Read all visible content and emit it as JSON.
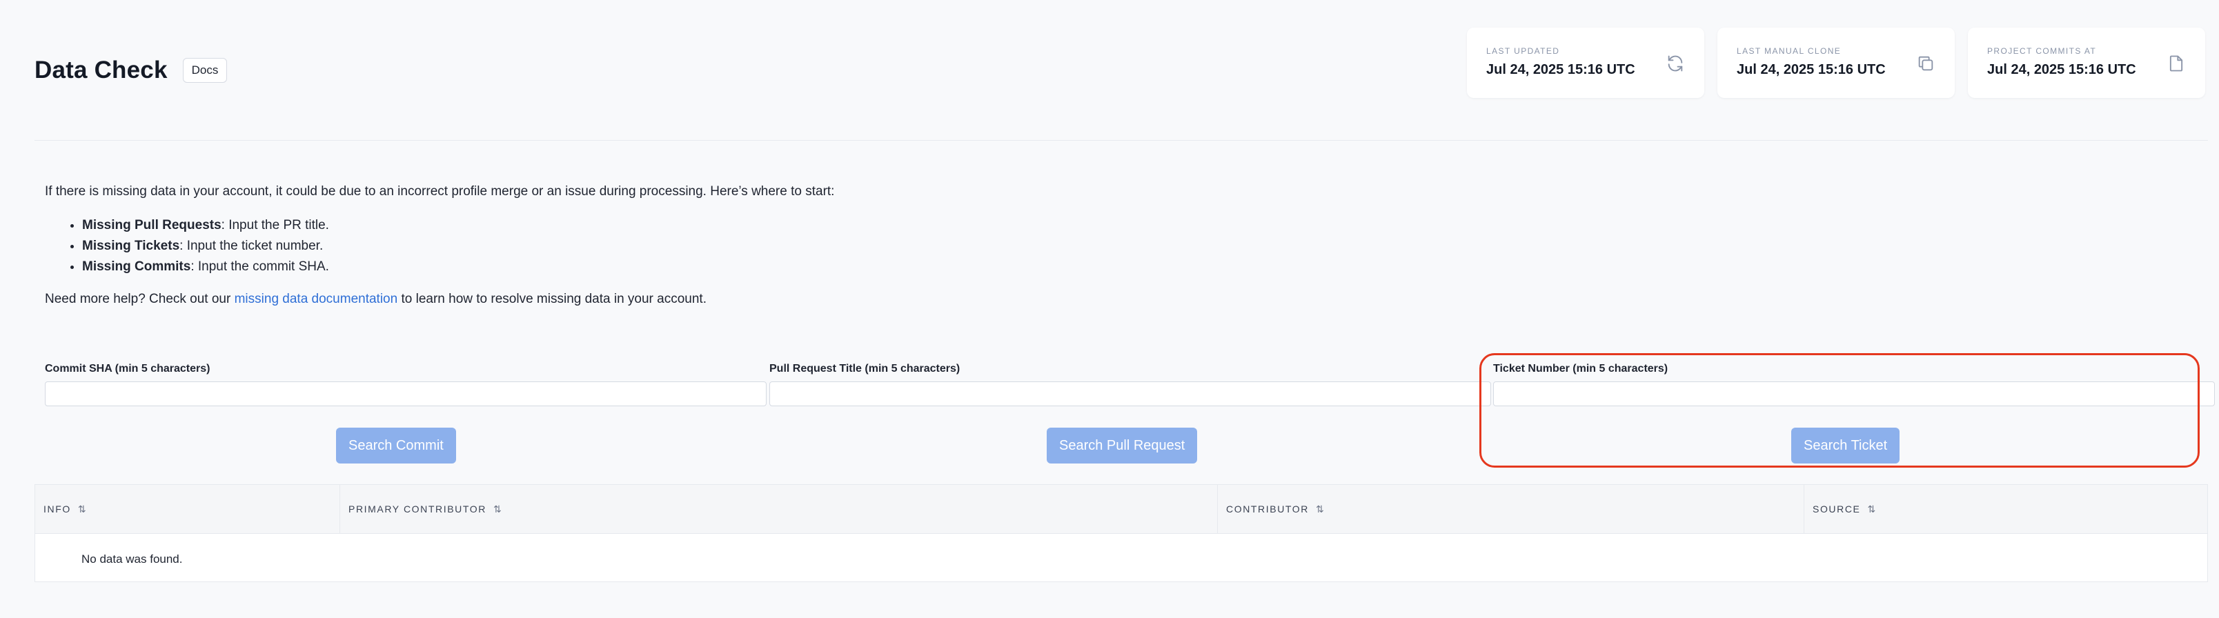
{
  "page": {
    "title": "Data Check",
    "docs_label": "Docs"
  },
  "stats": [
    {
      "label": "LAST UPDATED",
      "value": "Jul 24, 2025 15:16 UTC",
      "icon": "refresh-icon"
    },
    {
      "label": "LAST MANUAL CLONE",
      "value": "Jul 24, 2025 15:16 UTC",
      "icon": "copy-icon"
    },
    {
      "label": "PROJECT COMMITS AT",
      "value": "Jul 24, 2025 15:16 UTC",
      "icon": "document-icon"
    }
  ],
  "intro": {
    "lead": "If there is missing data in your account, it could be due to an incorrect profile merge or an issue during processing. Here’s where to start:",
    "items": [
      {
        "strong": "Missing Pull Requests",
        "rest": ": Input the PR title."
      },
      {
        "strong": "Missing Tickets",
        "rest": ": Input the ticket number."
      },
      {
        "strong": "Missing Commits",
        "rest": ": Input the commit SHA."
      }
    ],
    "help_before": "Need more help? Check out our ",
    "help_link": "missing data documentation",
    "help_after": " to learn how to resolve missing data in your account."
  },
  "search": {
    "commit": {
      "label": "Commit SHA (min 5 characters)",
      "value": "",
      "button": "Search Commit"
    },
    "pull_request": {
      "label": "Pull Request Title (min 5 characters)",
      "value": "",
      "button": "Search Pull Request"
    },
    "ticket": {
      "label": "Ticket Number (min 5 characters)",
      "value": "",
      "button": "Search Ticket"
    }
  },
  "table": {
    "columns": [
      "INFO",
      "PRIMARY CONTRIBUTOR",
      "CONTRIBUTOR",
      "SOURCE"
    ],
    "sort_glyph": "⇅",
    "empty": "No data was found."
  },
  "colors": {
    "accent": "#2f6fd6",
    "button": "#8cb0ec",
    "highlight": "#e5381e"
  }
}
